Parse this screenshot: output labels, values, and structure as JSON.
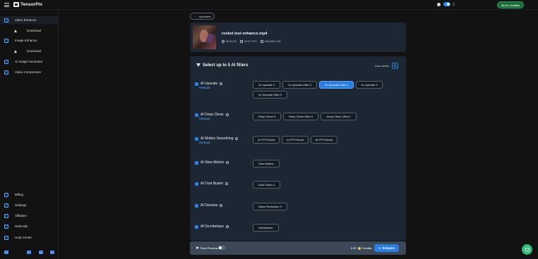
{
  "header": {
    "logo_text": "TensorPix",
    "moon_glyph": "☾",
    "credits_label": "44.8 ● Credits"
  },
  "sidebar": {
    "items": [
      {
        "label": "Video Enhance",
        "icon": "video-enhance-icon",
        "active": true
      },
      {
        "label": "Download",
        "icon": "download-icon",
        "sub": true
      },
      {
        "label": "Image Enhance",
        "icon": "image-enhance-icon"
      },
      {
        "label": "Download",
        "icon": "download-icon",
        "sub": true
      },
      {
        "label": "AI Image Generator",
        "icon": "ai-image-generator-icon"
      },
      {
        "label": "Video Compressor",
        "icon": "video-compressor-icon"
      }
    ],
    "bottom_items": [
      {
        "label": "Billing",
        "icon": "billing-icon"
      },
      {
        "label": "Settings",
        "icon": "settings-icon"
      },
      {
        "label": "Affiliates",
        "icon": "affiliates-icon"
      },
      {
        "label": "Referrals",
        "icon": "referrals-icon"
      },
      {
        "label": "Help Center",
        "icon": "help-center-icon"
      }
    ],
    "social_icons": [
      "discord-icon",
      "youtube-icon",
      "linkedin-icon",
      "x-icon"
    ]
  },
  "main": {
    "back_label": "Uploaded",
    "video": {
      "file_name": "rocket test enhance.mp4",
      "duration": "00:00:05",
      "fps": "29.97 FPS",
      "resolution": "852x480 | SD"
    },
    "filters_title": "Select up to 5 AI filters",
    "auto_select_label": "Auto select",
    "filters": [
      {
        "name": "AI Upscale",
        "tag": "POPULAR",
        "icon": "upscale-icon",
        "options": [
          {
            "label": "2x Upscale 3",
            "selected": false
          },
          {
            "label": "2x Upscale Ultra 3",
            "selected": false
          },
          {
            "label": "2x Upscale Ultra 4",
            "selected": true
          },
          {
            "label": "4x Upscale 3",
            "selected": false
          },
          {
            "label": "4x Upscale Ultra 3",
            "selected": false
          }
        ]
      },
      {
        "name": "AI Deep Clean",
        "tag": "POPULAR",
        "icon": "deep-clean-icon",
        "options": [
          {
            "label": "Deep Clean 3",
            "selected": false
          },
          {
            "label": "Deep Clean Ultra 3",
            "selected": false
          },
          {
            "label": "Deep Clean Ultra 4",
            "selected": false
          }
        ]
      },
      {
        "name": "AI Motion Smoothing",
        "tag": "POPULAR",
        "icon": "motion-smoothing-icon",
        "options": [
          {
            "label": "2x FPS Boost",
            "selected": false
          },
          {
            "label": "4x FPS Boost",
            "selected": false
          },
          {
            "label": "8x FPS Boost",
            "selected": false
          }
        ]
      },
      {
        "name": "AI Slow Motion",
        "tag": "",
        "icon": "slow-motion-icon",
        "options": [
          {
            "label": "Slow Motion",
            "selected": false
          }
        ]
      },
      {
        "name": "AI Dust Buster",
        "tag": "",
        "icon": "dust-buster-icon",
        "options": [
          {
            "label": "Dust Clean 2",
            "selected": false
          }
        ]
      },
      {
        "name": "AI Denoise",
        "tag": "",
        "icon": "denoise-icon",
        "options": [
          {
            "label": "Noise Reduction 3",
            "selected": false
          }
        ]
      },
      {
        "name": "AI De-interlace",
        "tag": "",
        "icon": "deinterlace-icon",
        "options": [
          {
            "label": "Deinterlace",
            "selected": false
          }
        ]
      }
    ],
    "bottom_bar": {
      "free_preview_label": "Free Preview",
      "free_preview_on": false,
      "cost_value": "0.57",
      "cost_unit": "Credits",
      "enhance_label": "Enhance"
    }
  },
  "colors": {
    "accent": "#2a7de1",
    "background": "#121212",
    "card": "#1c2733",
    "credits_green": "#1c6b3a",
    "chat_green": "#2fbf7a"
  }
}
